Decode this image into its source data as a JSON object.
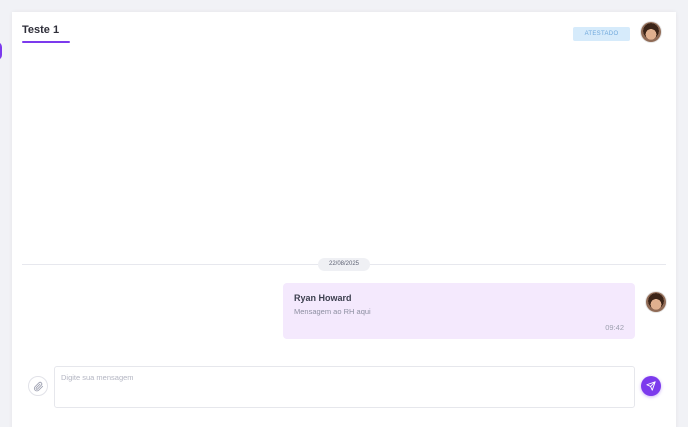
{
  "chat": {
    "title": "Teste 1",
    "status_badge": "ATESTADO"
  },
  "messages": [
    {
      "date": "22/08/2025",
      "sender": "Ryan Howard",
      "text": "Mensagem ao RH aqui",
      "time": "09:42"
    }
  ],
  "composer": {
    "placeholder": "Digite sua mensagem",
    "value": ""
  },
  "icons": {
    "attach": "paperclip-icon",
    "send": "send-icon"
  },
  "colors": {
    "accent": "#7c3aed",
    "bubble": "#f4e9fd",
    "badge_bg": "#d6ebfb",
    "badge_text": "#6fa8dc"
  }
}
